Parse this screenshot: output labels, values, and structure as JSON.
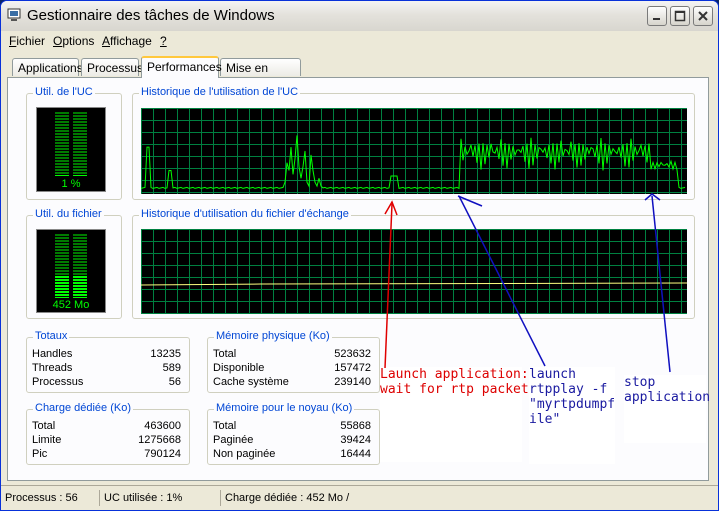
{
  "window": {
    "title": "Gestionnaire des tâches de Windows"
  },
  "menu": [
    {
      "label": "Fichier",
      "accel": "F",
      "rest": "ichier"
    },
    {
      "label": "Options",
      "accel": "O",
      "rest": "ptions"
    },
    {
      "label": "Affichage",
      "accel": "A",
      "rest": "ffichage"
    },
    {
      "label": "?",
      "accel": "?",
      "rest": ""
    }
  ],
  "tabs": [
    "Applications",
    "Processus",
    "Performances",
    "Mise en réseau"
  ],
  "active_tab": "Performances",
  "cpu": {
    "group_label": "Util. de l'UC",
    "value_text": "1 %",
    "usage_fraction": 0.01
  },
  "cpu_history": {
    "group_label": "Historique de l'utilisation de l'UC"
  },
  "pagefile": {
    "group_label": "Util. du fichier",
    "value_text": "452 Mo",
    "usage_fraction": 0.35
  },
  "pagefile_history": {
    "group_label": "Historique d'utilisation du fichier d'échange"
  },
  "totals": {
    "label": "Totaux",
    "rows": [
      {
        "k": "Handles",
        "v": "13235"
      },
      {
        "k": "Threads",
        "v": "589"
      },
      {
        "k": "Processus",
        "v": "56"
      }
    ]
  },
  "physical_memory": {
    "label": "Mémoire physique (Ko)",
    "rows": [
      {
        "k": "Total",
        "v": "523632"
      },
      {
        "k": "Disponible",
        "v": "157472"
      },
      {
        "k": "Cache système",
        "v": "239140"
      }
    ]
  },
  "commit_charge": {
    "label": "Charge dédiée (Ko)",
    "rows": [
      {
        "k": "Total",
        "v": "463600"
      },
      {
        "k": "Limite",
        "v": "1275668"
      },
      {
        "k": "Pic",
        "v": "790124"
      }
    ]
  },
  "kernel_memory": {
    "label": "Mémoire pour le noyau (Ko)",
    "rows": [
      {
        "k": "Total",
        "v": "55868"
      },
      {
        "k": "Paginée",
        "v": "39424"
      },
      {
        "k": "Non paginée",
        "v": "16444"
      }
    ]
  },
  "status": {
    "processes": "Processus : 56",
    "cpu": "UC utilisée : 1%",
    "commit": "Charge dédiée : 452 Mo /"
  },
  "annotations": [
    {
      "text": "Launch application:\nwait for rtp packets",
      "color": "#dd0000"
    },
    {
      "text": "launch\nrtpplay -f\n\"myrtpdumpf\nile\"",
      "color": "#1a1aa0"
    },
    {
      "text": "stop\napplication",
      "color": "#1a1aa0"
    }
  ],
  "colors": {
    "graph_grid": "#008040",
    "graph_line": "#00ff00",
    "pagefile_line": "#ffff80",
    "accent": "#0046d5"
  }
}
